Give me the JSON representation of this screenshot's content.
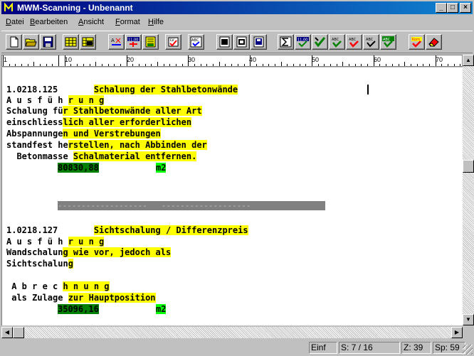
{
  "window": {
    "title": "MWM-Scanning - Unbenannt",
    "controls": {
      "minimize": "_",
      "maximize": "□",
      "close": "×"
    }
  },
  "menu": [
    {
      "label": "Datei",
      "accel": "D",
      "rest": "atei"
    },
    {
      "label": "Bearbeiten",
      "accel": "B",
      "rest": "earbeiten"
    },
    {
      "label": "Ansicht",
      "accel": "A",
      "rest": "nsicht"
    },
    {
      "label": "Format",
      "accel": "F",
      "rest": "ormat"
    },
    {
      "label": "Hilfe",
      "accel": "H",
      "rest": "ilfe"
    }
  ],
  "toolbar": {
    "icons": [
      "new-file-icon",
      "open-folder-icon",
      "save-icon",
      "grid-icon",
      "grid-alt-icon",
      "replace-icon",
      "number-format-icon",
      "list-icon",
      "checkbox-icon",
      "spellcheck-icon",
      "page-icon",
      "page-alt-icon",
      "page-save-icon",
      "sum-icon",
      "number-check-icon",
      "check-arrow-icon",
      "abc-check-icon",
      "abc-red-icon",
      "abc-check-alt-icon",
      "abc-green-icon",
      "red-check-icon",
      "eraser-icon"
    ],
    "labels": {
      "num": "11,00",
      "abc": "ABC",
      "lv": "LV",
      "kom": "Kom"
    }
  },
  "ruler": {
    "labels": [
      "1",
      "10",
      "20",
      "30",
      "40",
      "50",
      "60",
      "70"
    ]
  },
  "document": {
    "pos1": {
      "number": "1.0218.125",
      "title": "Schalung der Stahlbetonwände",
      "ausfuehrung_plain": "A u s f ü h ",
      "ausfuehrung_hl": "r u n g",
      "l1_plain": "Schalung fü",
      "l1_hl": "r Stahlbetonwände aller Art",
      "l2_plain": "einschliess",
      "l2_hl": "lich aller erforderlichen",
      "l3_plain": "Abspannunge",
      "l3_hl": "n und Verstrebungen",
      "l4_plain": "standfest he",
      "l4_hl": "rstellen, nach Abbinden der",
      "l5_plain": "  Betonmasse ",
      "l5_hl": "Schalmaterial entfernen.",
      "quantity": "80830,88",
      "unit": "m2"
    },
    "separator": "-------------------   -------------------",
    "pos2": {
      "number": "1.0218.127",
      "title": "Sichtschalung / Differenzpreis",
      "ausfuehrung_plain": "A u s f ü h ",
      "ausfuehrung_hl": "r u n g",
      "l1_plain": "Wandschalun",
      "l1_hl": "g wie vor, jedoch als",
      "l2_plain": "Sichtschalun",
      "l2_hl": "g",
      "abrechnung_plain": " A b r e c ",
      "abrechnung_hl": "h n u n g",
      "l3_plain": " als Zulage ",
      "l3_hl": "zur Hauptposition",
      "quantity": "35096,16",
      "unit": "m2"
    }
  },
  "status": {
    "mode": "Einf",
    "page": "S: 7 / 16",
    "line": "Z: 39",
    "column": "Sp: 59"
  },
  "colors": {
    "highlight_yellow": "#ffff00",
    "highlight_darkgreen": "#008000",
    "highlight_lightgreen": "#00ff00",
    "titlebar": "#000080"
  }
}
